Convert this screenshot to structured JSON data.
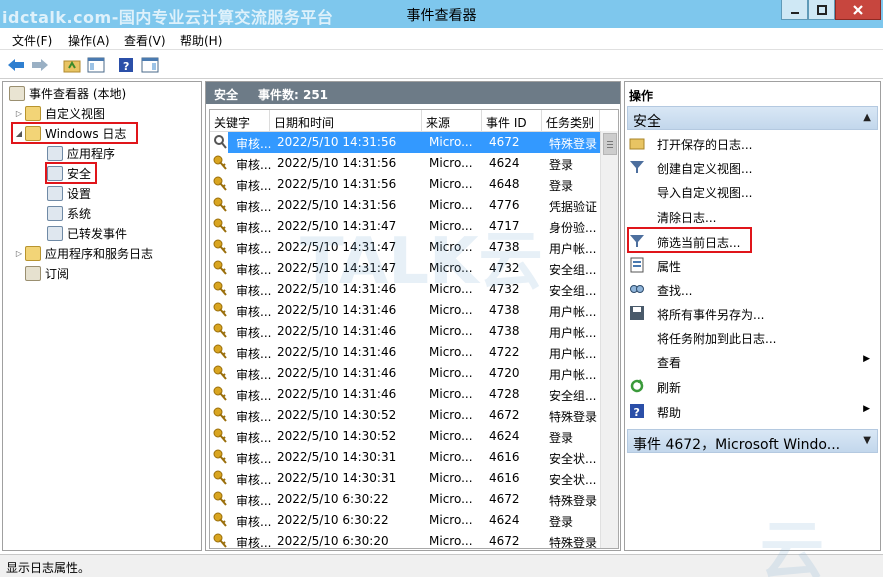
{
  "window": {
    "title": "事件查看器",
    "watermark": "idctalk.com-国内专业云计算交流服务平台"
  },
  "menu": [
    "文件(F)",
    "操作(A)",
    "查看(V)",
    "帮助(H)"
  ],
  "tree": {
    "root": "事件查看器 (本地)",
    "custom_views": "自定义视图",
    "windows_logs": "Windows 日志",
    "application": "应用程序",
    "security": "安全",
    "setup": "设置",
    "system": "系统",
    "forwarded": "已转发事件",
    "apps_services": "应用程序和服务日志",
    "subscriptions": "订阅"
  },
  "center": {
    "log_name": "安全",
    "event_count": "事件数: 251",
    "columns": [
      "关键字",
      "日期和时间",
      "来源",
      "事件 ID",
      "任务类别"
    ],
    "rows": [
      [
        "审核...",
        "2022/5/10 14:31:56",
        "Micro...",
        "4672",
        "特殊登录"
      ],
      [
        "审核...",
        "2022/5/10 14:31:56",
        "Micro...",
        "4624",
        "登录"
      ],
      [
        "审核...",
        "2022/5/10 14:31:56",
        "Micro...",
        "4648",
        "登录"
      ],
      [
        "审核...",
        "2022/5/10 14:31:56",
        "Micro...",
        "4776",
        "凭据验证"
      ],
      [
        "审核...",
        "2022/5/10 14:31:47",
        "Micro...",
        "4717",
        "身份验..."
      ],
      [
        "审核...",
        "2022/5/10 14:31:47",
        "Micro...",
        "4738",
        "用户帐..."
      ],
      [
        "审核...",
        "2022/5/10 14:31:47",
        "Micro...",
        "4732",
        "安全组..."
      ],
      [
        "审核...",
        "2022/5/10 14:31:46",
        "Micro...",
        "4732",
        "安全组..."
      ],
      [
        "审核...",
        "2022/5/10 14:31:46",
        "Micro...",
        "4738",
        "用户帐..."
      ],
      [
        "审核...",
        "2022/5/10 14:31:46",
        "Micro...",
        "4738",
        "用户帐..."
      ],
      [
        "审核...",
        "2022/5/10 14:31:46",
        "Micro...",
        "4722",
        "用户帐..."
      ],
      [
        "审核...",
        "2022/5/10 14:31:46",
        "Micro...",
        "4720",
        "用户帐..."
      ],
      [
        "审核...",
        "2022/5/10 14:31:46",
        "Micro...",
        "4728",
        "安全组..."
      ],
      [
        "审核...",
        "2022/5/10 14:30:52",
        "Micro...",
        "4672",
        "特殊登录"
      ],
      [
        "审核...",
        "2022/5/10 14:30:52",
        "Micro...",
        "4624",
        "登录"
      ],
      [
        "审核...",
        "2022/5/10 14:30:31",
        "Micro...",
        "4616",
        "安全状..."
      ],
      [
        "审核...",
        "2022/5/10 14:30:31",
        "Micro...",
        "4616",
        "安全状..."
      ],
      [
        "审核...",
        "2022/5/10 6:30:22",
        "Micro...",
        "4672",
        "特殊登录"
      ],
      [
        "审核...",
        "2022/5/10 6:30:22",
        "Micro...",
        "4624",
        "登录"
      ],
      [
        "审核...",
        "2022/5/10 6:30:20",
        "Micro...",
        "4672",
        "特殊登录"
      ]
    ]
  },
  "actions": {
    "title": "操作",
    "section1": "安全",
    "items": [
      "打开保存的日志...",
      "创建自定义视图...",
      "导入自定义视图...",
      "清除日志...",
      "筛选当前日志...",
      "属性",
      "查找...",
      "将所有事件另存为...",
      "将任务附加到此日志...",
      "查看",
      "刷新",
      "帮助"
    ],
    "section2": "事件 4672，Microsoft Windo..."
  },
  "status": "显示日志属性。",
  "colors": {
    "titlebar": "#7ec7ed",
    "selection": "#3399ff",
    "highlight": "#e0151a",
    "pane_header": "#6d7b87"
  }
}
